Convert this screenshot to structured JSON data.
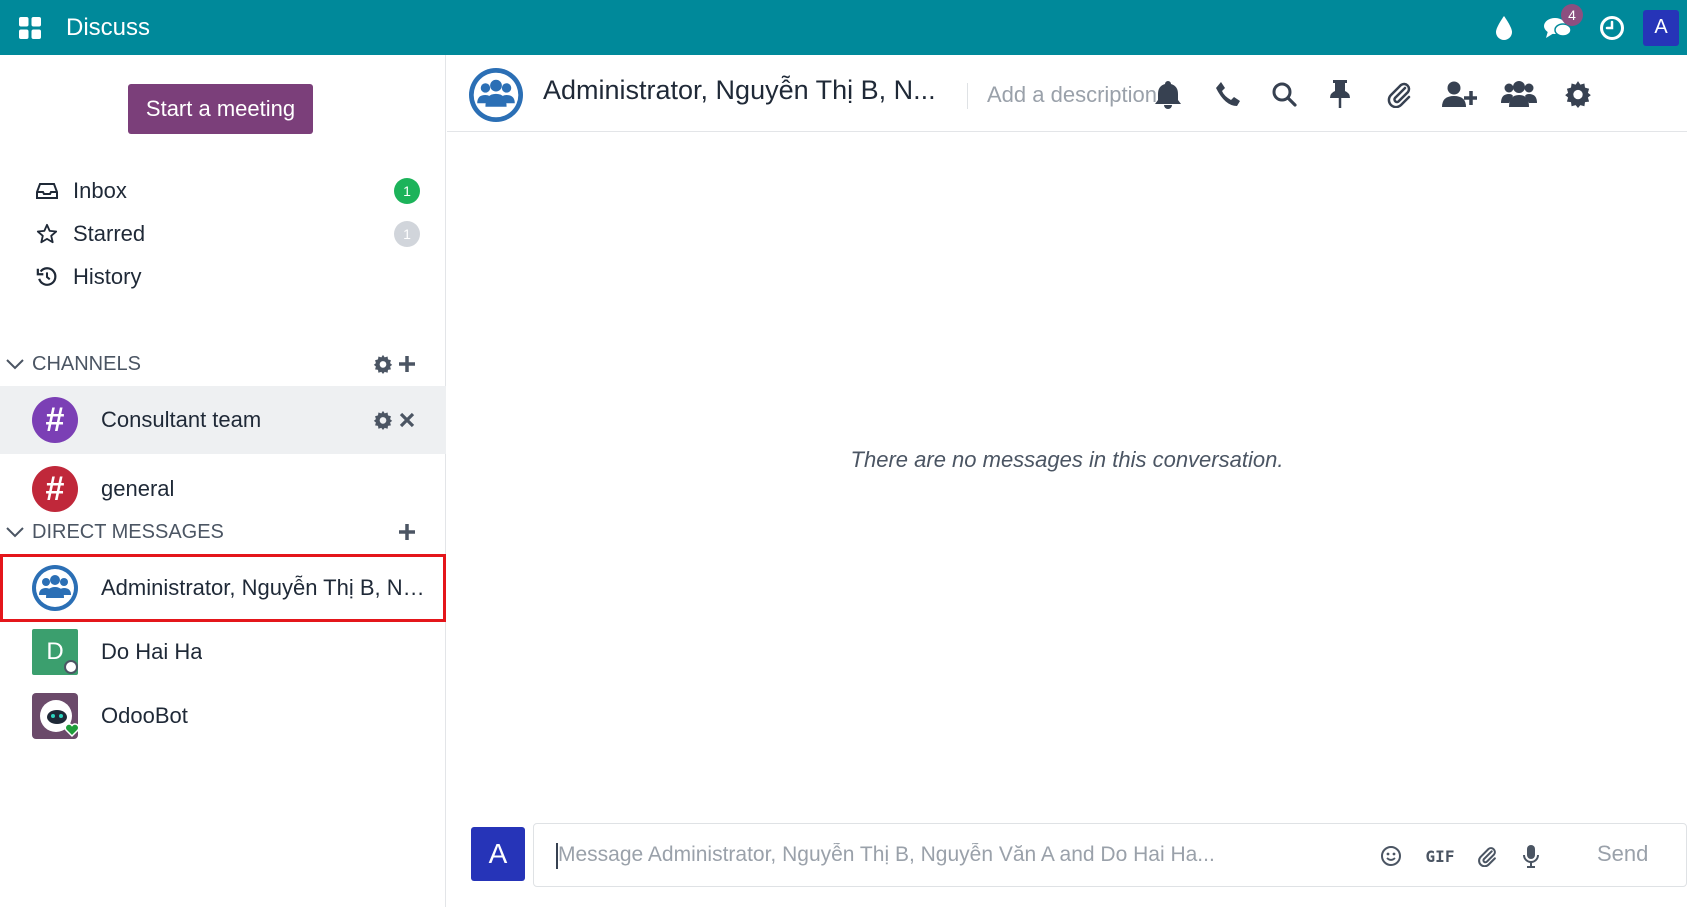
{
  "app": {
    "title": "Discuss"
  },
  "topbar": {
    "chat_badge": "4",
    "user_initial": "A"
  },
  "sidebar": {
    "start_meeting": "Start a meeting",
    "mailboxes": [
      {
        "label": "Inbox",
        "count": "1",
        "icon": "inbox-icon",
        "badge_color": "#1cb35a"
      },
      {
        "label": "Starred",
        "count": "1",
        "icon": "star-icon",
        "badge_color": "#d1d5db"
      },
      {
        "label": "History",
        "count": "",
        "icon": "history-icon"
      }
    ],
    "channels_label": "CHANNELS",
    "channels": [
      {
        "name": "Consultant team",
        "color": "#7b3fb5"
      },
      {
        "name": "general",
        "color": "#c0283a"
      }
    ],
    "direct_label": "DIRECT MESSAGES",
    "direct": [
      {
        "name": "Administrator, Nguyễn Thị B, Ng..."
      },
      {
        "name": "Do Hai Ha",
        "initial": "D",
        "color": "#3b9f6e"
      },
      {
        "name": "OdooBot"
      }
    ]
  },
  "thread": {
    "title": "Administrator, Nguyễn Thị B, N...",
    "description_placeholder": "Add a description",
    "empty_text": "There are no messages in this conversation."
  },
  "composer": {
    "avatar_initial": "A",
    "placeholder": "Message Administrator, Nguyễn Thị B, Nguyễn Văn A and Do Hai Ha...",
    "gif_label": "GIF",
    "send_label": "Send"
  },
  "colors": {
    "topbar": "#00899a",
    "accent": "#7b3f7a",
    "selection": "#e4161b",
    "group_avatar": "#2b6fb5"
  }
}
